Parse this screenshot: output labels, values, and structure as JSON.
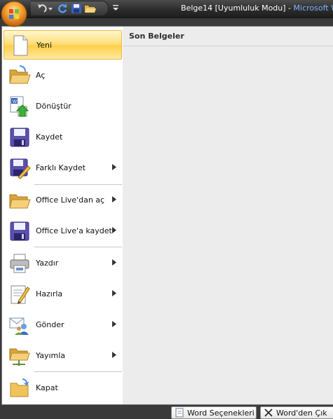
{
  "titlebar": {
    "document": "Belge14 [Uyumluluk Modu]",
    "separator": " - ",
    "app": "Microsoft Wo"
  },
  "menu": {
    "items": [
      {
        "label": "Yeni",
        "icon": "new-document-icon",
        "submenu": false,
        "selected": true
      },
      {
        "label": "Aç",
        "icon": "open-folder-icon",
        "submenu": false
      },
      {
        "label": "Dönüştür",
        "icon": "convert-icon",
        "submenu": false
      },
      {
        "label": "Kaydet",
        "icon": "save-disk-icon",
        "submenu": false
      },
      {
        "label": "Farklı Kaydet",
        "icon": "save-as-icon",
        "submenu": true
      },
      {
        "label": "Office Live'dan aç",
        "icon": "open-folder-icon",
        "submenu": true
      },
      {
        "label": "Office Live'a kaydet",
        "icon": "save-disk-icon",
        "submenu": true
      },
      {
        "label": "Yazdır",
        "icon": "printer-icon",
        "submenu": true
      },
      {
        "label": "Hazırla",
        "icon": "prepare-icon",
        "submenu": true
      },
      {
        "label": "Gönder",
        "icon": "send-icon",
        "submenu": true
      },
      {
        "label": "Yayımla",
        "icon": "publish-icon",
        "submenu": true
      },
      {
        "label": "Kapat",
        "icon": "close-folder-icon",
        "submenu": false
      }
    ]
  },
  "recent": {
    "header": "Son Belgeler"
  },
  "bottom": {
    "options_label": "Word Seçenekleri",
    "exit_label": "Word'den Çık"
  },
  "colors": {
    "accent": "#ffdf7c",
    "title_app": "#7fb4ff"
  }
}
